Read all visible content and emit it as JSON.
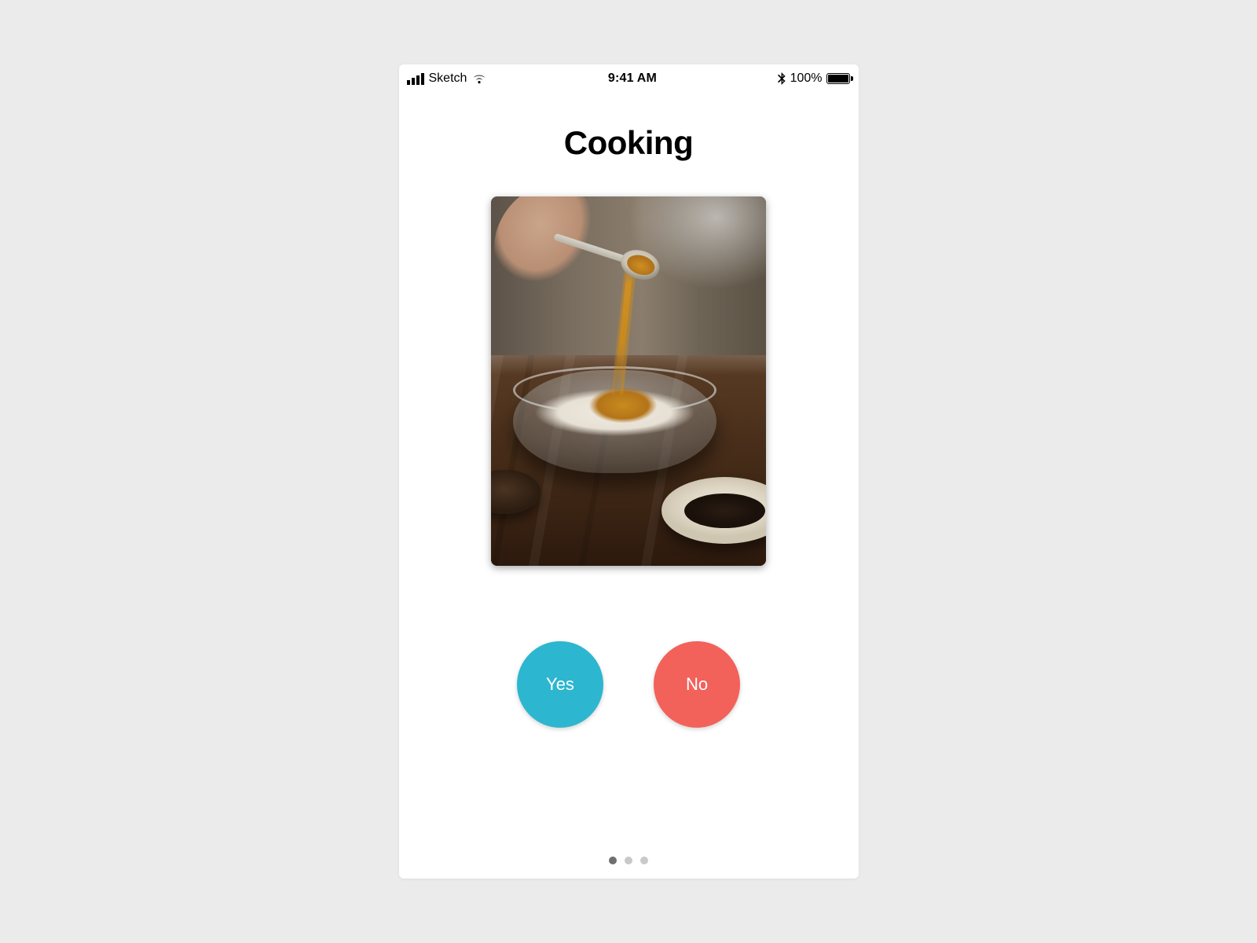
{
  "status_bar": {
    "carrier": "Sketch",
    "time": "9:41 AM",
    "battery_pct": "100%"
  },
  "card": {
    "title": "Cooking",
    "image_alt": "Hand sprinkling golden spice from a spoon into a glass bowl of flour on a wooden table"
  },
  "buttons": {
    "yes": "Yes",
    "no": "No"
  },
  "pager": {
    "count": 3,
    "active_index": 0
  },
  "colors": {
    "yes": "#2db6cf",
    "no": "#f3615b"
  }
}
